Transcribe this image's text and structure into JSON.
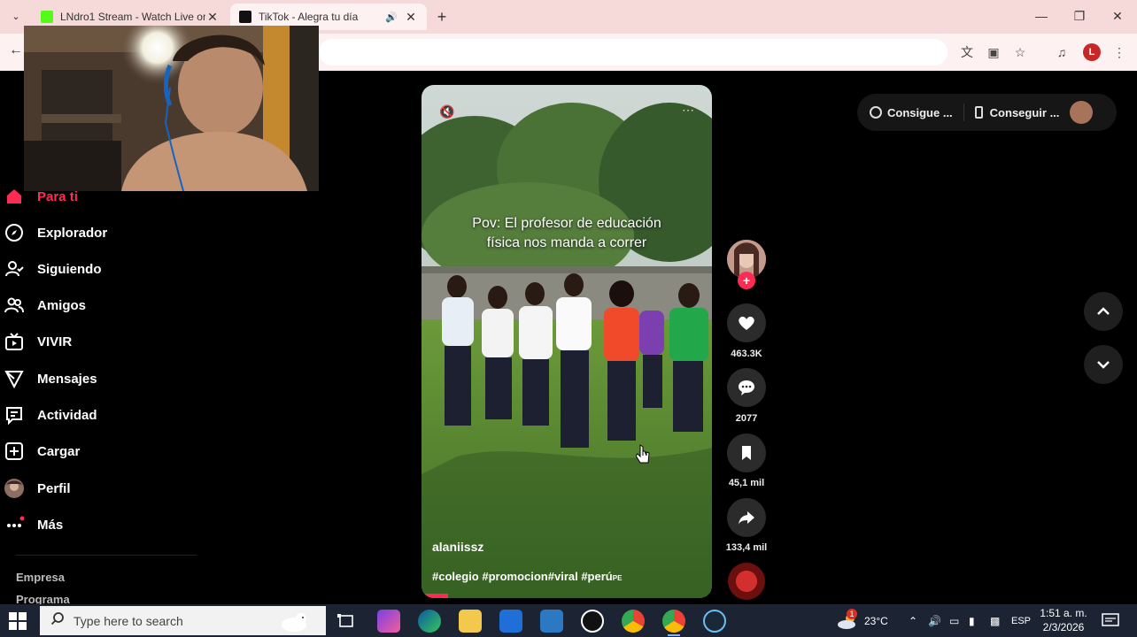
{
  "browser": {
    "tabs": [
      {
        "title": "LNdro1 Stream - Watch Live on",
        "active": false
      },
      {
        "title": "TikTok - Alegra tu día",
        "active": true
      }
    ]
  },
  "sidebar": {
    "items": [
      {
        "label": "Para ti",
        "icon": "home-icon",
        "active": true
      },
      {
        "label": "Explorador",
        "icon": "compass-icon"
      },
      {
        "label": "Siguiendo",
        "icon": "following-icon"
      },
      {
        "label": "Amigos",
        "icon": "friends-icon"
      },
      {
        "label": "VIVIR",
        "icon": "live-tv-icon"
      },
      {
        "label": "Mensajes",
        "icon": "send-icon"
      },
      {
        "label": "Actividad",
        "icon": "activity-icon"
      },
      {
        "label": "Cargar",
        "icon": "upload-plus-icon"
      },
      {
        "label": "Perfil",
        "icon": "profile-avatar-icon"
      },
      {
        "label": "Más",
        "icon": "more-dots-icon"
      }
    ],
    "footer": [
      "Empresa",
      "Programa"
    ]
  },
  "video": {
    "caption_line1": "Pov: El profesor  de educación",
    "caption_line2": "física nos manda a correr",
    "author": "alaniissz",
    "tags": "#colegio #promocion#viral #perú",
    "tags_suffix": "PE"
  },
  "actions": {
    "likes": "463.3K",
    "comments": "2077",
    "saves": "45,1 mil",
    "shares": "133,4 mil"
  },
  "get_app": {
    "coins_label": "Consigue ...",
    "app_label": "Conseguir ..."
  },
  "taskbar": {
    "search_placeholder": "Type here to search",
    "weather": "23°C",
    "weather_badge": "1",
    "language": "ESP",
    "time": "1:51 a. m.",
    "date": "2/3/2026"
  },
  "colors": {
    "accent": "#fe2c55",
    "tab_strip": "#f6d9d9",
    "taskbar": "#1c2333"
  }
}
